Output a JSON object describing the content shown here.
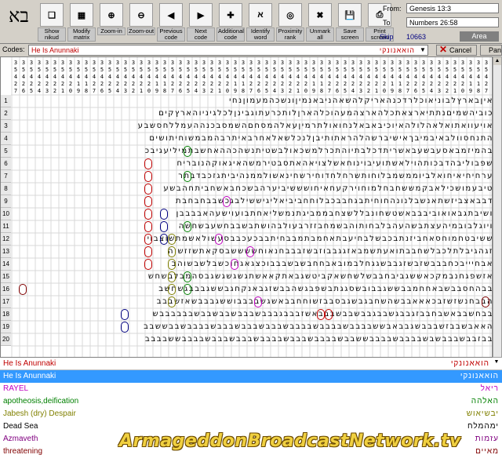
{
  "logo": "בא",
  "toolbar": {
    "buttons": [
      {
        "label": "Show\nnikud",
        "icon": "book-icon"
      },
      {
        "label": "Modify\nmatrix",
        "icon": "matrix-icon"
      },
      {
        "label": "Zoom-in",
        "icon": "zoom-in-icon"
      },
      {
        "label": "Zoom-out",
        "icon": "zoom-out-icon"
      },
      {
        "label": "Previous\ncode",
        "icon": "previous-icon"
      },
      {
        "label": "Next\ncode",
        "icon": "next-icon"
      },
      {
        "label": "Additional\ncode",
        "icon": "additional-icon"
      },
      {
        "label": "Identify\nword",
        "icon": "identify-icon"
      },
      {
        "label": "Proximity\nrank",
        "icon": "proximity-icon"
      },
      {
        "label": "Unmark\nall",
        "icon": "unmark-icon"
      },
      {
        "label": "Save\nscreen",
        "icon": "save-icon"
      },
      {
        "label": "Print\nscreen",
        "icon": "print-icon"
      }
    ]
  },
  "location": {
    "from_label": "From:",
    "from_value": "Genesis 13:3",
    "to_label": "To",
    "to_value": "Numbers 26:58",
    "skip_label": "Skip",
    "skip_value": "10663",
    "area_label": "Area"
  },
  "codes": {
    "label": "Codes:",
    "value": "He Is Anunnaki",
    "hebrew": "הואאנונקי",
    "cancel_label": "Cancel",
    "pan_label": "Pan"
  },
  "grid": {
    "row_numbers": [
      "1",
      "2",
      "3",
      "4",
      "5",
      "6",
      "7",
      "8",
      "9",
      "10",
      "11",
      "12",
      "13",
      "14",
      "15",
      "16",
      "17",
      "18",
      "19",
      "20"
    ],
    "rows": [
      "איןבארץלבוניאוכלרדכנהאריקלהשאהניבאנמיןונשכהמעמוןנחי",
      "כוביהשמיםנתתיארצאתכלהארצהמעהוכלהארןלותכרעתוגבינןלכלגיניוהארץקים",
      "אויעוואתואלאהלולהאיוכיבאבאלנחואולתרמיןעאלהמסחםהשמסבכנההעמללחסשבע",
      "התנחסוולבאיבמיבךאישיברשהלהראתותיבןלנכלשאלאחרבאיתרבהמבמשוחיתושים",
      "בהמיזמבאסעבשעבאשריתדכלבתיוהתכרלמשכאולבשטיתנשהכההאחשבתמיליעגיבכ",
      "שפבוליבהדבכותהוילאשתועיבוינוחאשלצויאהאתסבטירמשהאיגאוקהנובריח",
      "ערחיחיאיחואלביוממשמבלוחותשרחלחדוחירשחינאשולממנהיביתגזכבדבתר",
      "טיבעמושכילאבקמששחבחלמוחוירקעחאיחושששיביערהבשכחבאשחביתחהבשע",
      "דבבאצביזשתאנשבלנונהחוחיתבגחבבכבלוחחביביאליגיששילבגכשבבחבחבת",
      "ושיבתגבאואוביבבבאשטשחונבללשצחבממביגתנמשליאחתבועוישעהאבבבבן",
      "ויוגלבובמיהעצתבשהעהבלבחותוהבשמחבזזרבעולבהושתבשבבחשעבשחשה",
      "ששיבטחמוחסאחביזנתבכבשלבחיעבתאחמבתמבבחיתבבכעכבבסעשולאשמתשוצבוי",
      "זגהגיבלתלכבלשחבבתואעתשמבאזגגבבוזבשזבבבחנאוחששששבסקאתשזזשוה",
      "אבחיייבכחבבבשזבשזגבבשגגחלבמובאבחחבשבשבבבוכצגאגחוכשבלשבשוהב",
      "אזשפגחנבמקכאששגביבחבבשלשחשאקביטשגבאתקאאשתגשגשגשגבסהמבלבשחש",
      "בבהחסבבשבאחחמבבששגבבובשסגגתבשפבגשהבבשזגבאנקחגבששגבבבגשחשב",
      "הבבחנשזשזבכאאאבבשהשחבגבשגבסבבזשוחחבבאשגשבבבבוששגבבבשאזשבבב",
      "בבחשבבאשבחבבזגבבגשבבגבבשבבשבבבאשזבבבגבבבשבבבשבבשבבשבבבבבבש",
      "האאבשבבזשבבבשגבבאבששבבבבשבבבבשבבבבשבבבשבבבשבבבשבבבבשבבששבב",
      "בבזבבשבבבשבשבבבבשבבבבששבבשבבבבשבבבשבבבבשבבבשבבבשבבבבששבבבב"
    ]
  },
  "results": {
    "header_value": "He Is Anunnaki",
    "header_hebrew": "הואאנונקי",
    "items": [
      {
        "label": "He Is Anunnaki",
        "hebrew": "הואאנונקי",
        "color": "#ffffff",
        "selected": true
      },
      {
        "label": "RAYEL",
        "hebrew": "ריאל",
        "color": "#c000c0",
        "selected": false
      },
      {
        "label": "apotheosis,deification",
        "hebrew": "האלהה",
        "color": "#008000",
        "selected": false
      },
      {
        "label": "Jabesh (dry) Despair",
        "hebrew": "יבשיאוש",
        "color": "#808000",
        "selected": false
      },
      {
        "label": "Dead Sea",
        "hebrew": "ימהמלח",
        "color": "#000000",
        "selected": false
      },
      {
        "label": "Azmaveth",
        "hebrew": "עזמות",
        "color": "#800080",
        "selected": false
      },
      {
        "label": "threatening",
        "hebrew": "מאיים",
        "color": "#800000",
        "selected": false
      }
    ]
  },
  "watermark": "ArmageddonBroadcastNetwork.tv"
}
